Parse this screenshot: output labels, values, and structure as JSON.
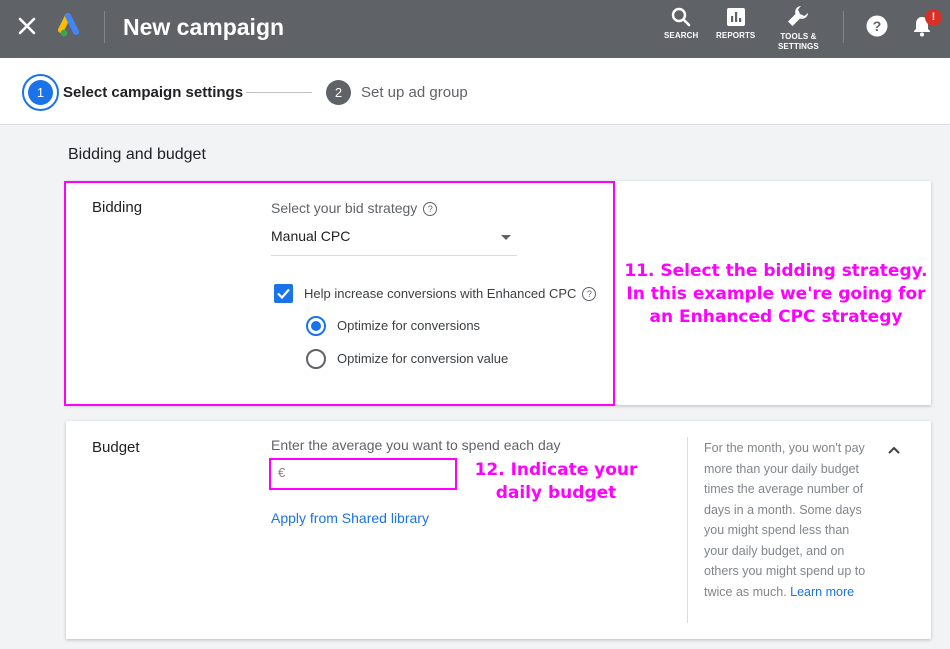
{
  "header": {
    "title": "New campaign",
    "tools": [
      {
        "label": "SEARCH",
        "icon": "search-icon"
      },
      {
        "label": "REPORTS",
        "icon": "reports-icon"
      },
      {
        "label_line1": "TOOLS &",
        "label_line2": "SETTINGS",
        "icon": "wrench-icon"
      }
    ],
    "notification_badge": "!"
  },
  "stepper": {
    "steps": [
      {
        "number": "1",
        "label": "Select campaign settings",
        "active": true
      },
      {
        "number": "2",
        "label": "Set up ad group",
        "active": false
      }
    ]
  },
  "section_title": "Bidding and budget",
  "bidding": {
    "row_label": "Bidding",
    "strategy_label": "Select your bid strategy",
    "strategy_value": "Manual CPC",
    "enhanced_cpc_label": "Help increase conversions with Enhanced CPC",
    "enhanced_cpc_checked": true,
    "options": [
      {
        "label": "Optimize for conversions",
        "selected": true
      },
      {
        "label": "Optimize for conversion value",
        "selected": false
      }
    ],
    "annotation": [
      "11. Select the bidding strategy.",
      "In this example we're going for",
      "an Enhanced CPC strategy"
    ]
  },
  "budget": {
    "row_label": "Budget",
    "prompt": "Enter the average you want to spend each day",
    "currency_symbol": "€",
    "shared_library_link": "Apply from Shared library",
    "help_text": "For the month, you won't pay more than your daily budget times the average number of days in a month. Some days you might spend less than your daily budget, and on others you might spend up to twice as much.",
    "learn_more": "Learn more",
    "annotation": [
      "12. Indicate your",
      "daily budget"
    ]
  },
  "colors": {
    "topbar": "#5f6368",
    "accent": "#1a73e8",
    "annotation": "#ff00ff",
    "badge": "#d93025"
  }
}
